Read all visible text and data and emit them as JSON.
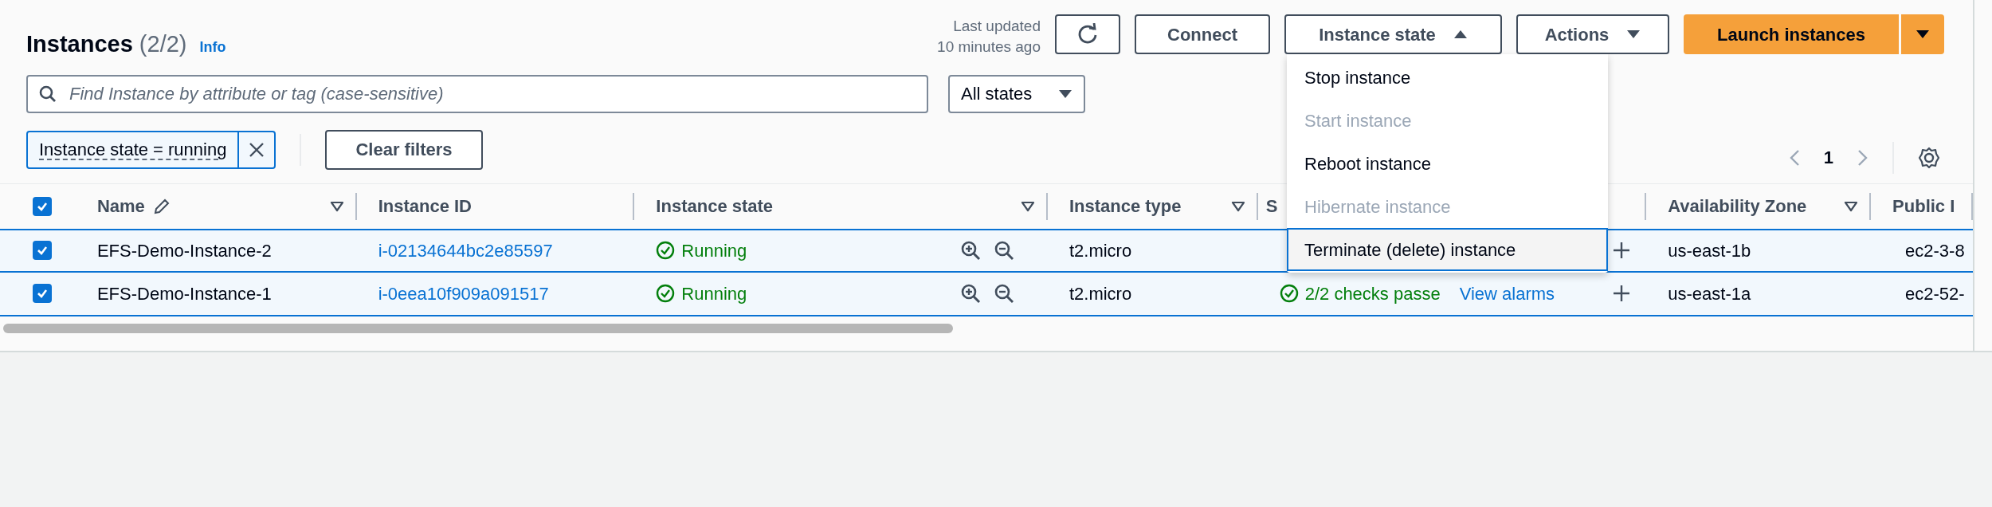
{
  "header": {
    "title": "Instances",
    "count": "(2/2)",
    "info": "Info",
    "last_updated": [
      "Last updated",
      "10 minutes ago"
    ]
  },
  "buttons": {
    "connect": "Connect",
    "instance_state": "Instance state",
    "actions": "Actions",
    "launch": "Launch instances"
  },
  "search": {
    "placeholder": "Find Instance by attribute or tag (case-sensitive)"
  },
  "state_filter": {
    "value": "All states"
  },
  "filter_tokens": [
    {
      "label": "Instance state = running"
    }
  ],
  "clear_filters": "Clear filters",
  "pagination": {
    "page": "1"
  },
  "menu": {
    "expanded": true,
    "items": [
      {
        "label": "Stop instance",
        "disabled": false,
        "selected": false
      },
      {
        "label": "Start instance",
        "disabled": true,
        "selected": false
      },
      {
        "label": "Reboot instance",
        "disabled": false,
        "selected": false
      },
      {
        "label": "Hibernate instance",
        "disabled": true,
        "selected": false
      },
      {
        "label": "Terminate (delete) instance",
        "disabled": false,
        "selected": true
      }
    ]
  },
  "table": {
    "all_checked": true,
    "columns": [
      {
        "label": "Name",
        "filter": true
      },
      {
        "label": "Instance ID",
        "filter": false
      },
      {
        "label": "Instance state",
        "filter": true
      },
      {
        "label": "Instance type",
        "filter": true
      },
      {
        "label": "S",
        "filter": false
      },
      {
        "label": "Availability Zone",
        "filter": true
      },
      {
        "label": "Public I",
        "filter": false
      }
    ],
    "rows": [
      {
        "checked": true,
        "name": "EFS-Demo-Instance-2",
        "instance_id": "i-02134644bc2e85597",
        "state": "Running",
        "type": "t2.micro",
        "az": "us-east-1b",
        "public": "ec2-3-8"
      },
      {
        "checked": true,
        "name": "EFS-Demo-Instance-1",
        "instance_id": "i-0eea10f909a091517",
        "state": "Running",
        "type": "t2.micro",
        "status": "2/2 checks passe",
        "alarms": "View alarms",
        "az": "us-east-1a",
        "public": "ec2-52-"
      }
    ]
  }
}
